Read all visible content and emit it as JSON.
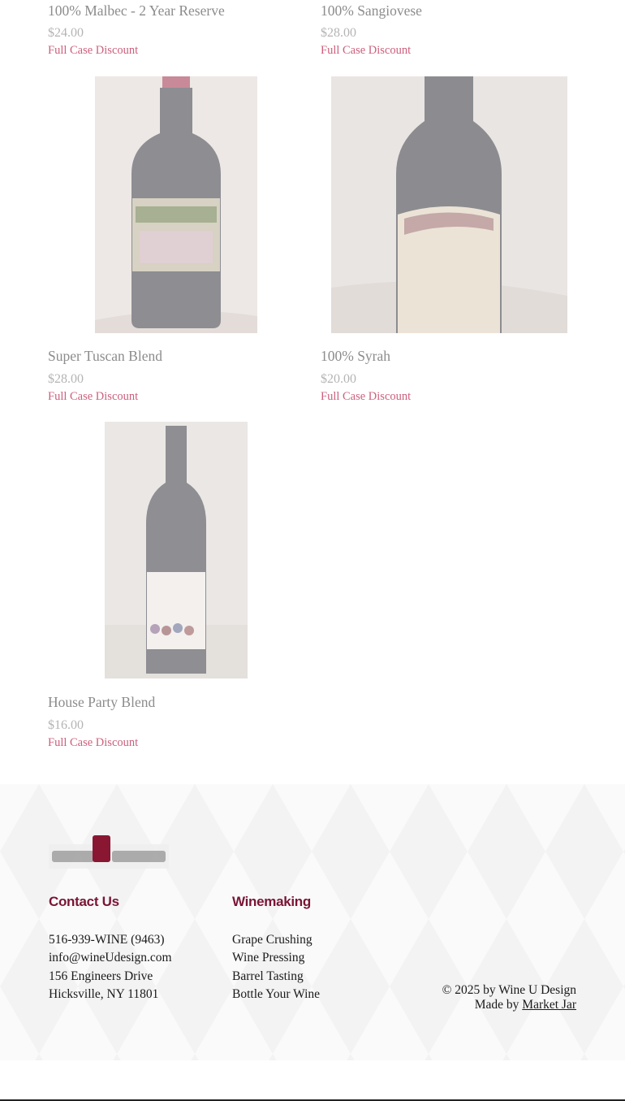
{
  "products": [
    {
      "title": "100% Malbec - 2 Year Reserve",
      "price": "$24.00",
      "discount": "Full Case Discount"
    },
    {
      "title": "100% Sangiovese",
      "price": "$28.00",
      "discount": "Full Case Discount"
    },
    {
      "title": "Super Tuscan Blend",
      "price": "$28.00",
      "discount": "Full Case Discount"
    },
    {
      "title": "100% Syrah",
      "price": "$20.00",
      "discount": "Full Case Discount"
    },
    {
      "title": "House Party Blend",
      "price": "$16.00",
      "discount": "Full Case Discount"
    }
  ],
  "footer": {
    "contact": {
      "heading": "Contact Us",
      "phone": "516-939-WINE (9463)",
      "email": "info@wineUdesign.com",
      "address1": "156 Engineers Drive",
      "address2": "Hicksville, NY 11801"
    },
    "winemaking": {
      "heading": "Winemaking",
      "items": [
        "Grape Crushing",
        "Wine Pressing",
        "Barrel Tasting",
        "Bottle Your Wine"
      ]
    },
    "copyright": "© 2025 by Wine U Design",
    "made_by_prefix": "Made by",
    "made_by_link": "Market Jar"
  },
  "colors": {
    "heading": "#7a1535",
    "discount": "#cc5f7c",
    "title_faded": "#8c8c8c",
    "price_faded": "#b4b4b4"
  }
}
